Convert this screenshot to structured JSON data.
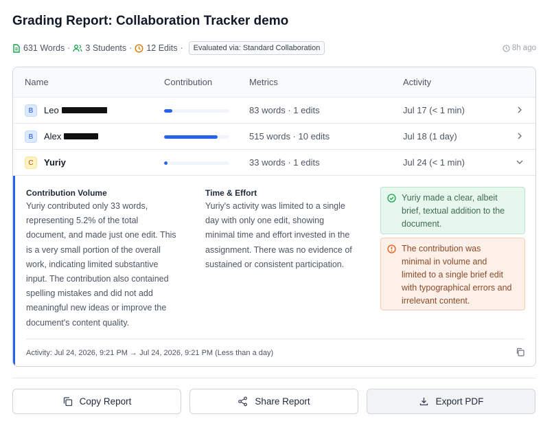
{
  "title": "Grading Report: Collaboration Tracker demo",
  "meta": {
    "words": "631 Words",
    "students": "3 Students",
    "edits": "12 Edits",
    "separator": "·",
    "evaluated": "Evaluated via: Standard Collaboration",
    "ago": "8h ago"
  },
  "table": {
    "headers": {
      "name": "Name",
      "contribution": "Contribution",
      "metrics": "Metrics",
      "activity": "Activity"
    },
    "rows": [
      {
        "initial": "B",
        "name": "Leo",
        "contribution_fraction": 0.13,
        "metrics": "83 words · 1 edits",
        "activity": "Jul 17 (< 1 min)"
      },
      {
        "initial": "B",
        "name": "Alex",
        "contribution_fraction": 0.82,
        "metrics": "515 words · 10 edits",
        "activity": "Jul 18 (1 day)"
      },
      {
        "initial": "C",
        "name": "Yuriy",
        "contribution_fraction": 0.05,
        "metrics": "33 words · 1 edits",
        "activity": "Jul 24 (< 1 min)"
      }
    ]
  },
  "detail": {
    "volume_title": "Contribution Volume",
    "volume_lines": [
      "Yuriy contributed only 33 words,",
      "representing 5.2% of the total",
      "document, and made just one edit. This",
      "is a very small portion of the overall",
      "work, indicating limited substantive",
      "input. The contribution also contained",
      "spelling mistakes and did not add",
      "meaningful new ideas or improve the",
      "document's content quality."
    ],
    "effort_title": "Time & Effort",
    "effort_lines": [
      "Yuriy's activity was limited to a single",
      "day with only one edit, showing",
      "minimal time and effort invested in the",
      "assignment. There was no evidence of",
      "sustained or consistent participation."
    ],
    "positive_lines": [
      "Yuriy made a clear, albeit",
      "brief, textual addition to the",
      "document."
    ],
    "warning_lines": [
      "The contribution was",
      "minimal in volume and",
      "limited to a single brief edit",
      "with typographical errors and",
      "irrelevant content."
    ],
    "activity_line": "Activity: Jul 24, 2026, 9:21 PM → Jul 24, 2026, 9:21 PM (Less than a day)"
  },
  "actions": {
    "copy": "Copy Report",
    "share": "Share Report",
    "export": "Export PDF"
  },
  "colors": {
    "accent": "#2563eb",
    "positive_bg": "#e8f7ee",
    "warning_bg": "#fdf0e8"
  }
}
